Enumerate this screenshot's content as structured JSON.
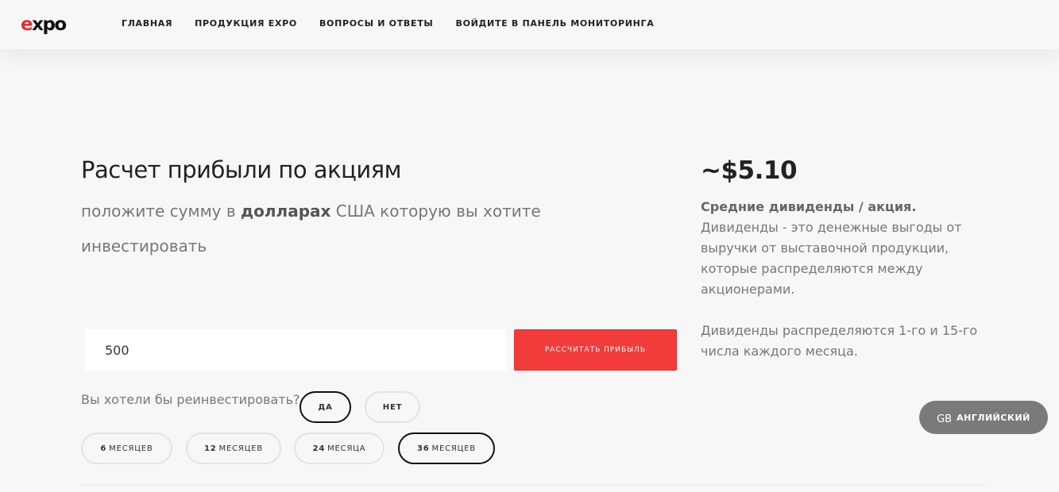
{
  "brand": {
    "logo_e": "e",
    "logo_rest": "xpo",
    "accent_color": "#e52d2d"
  },
  "nav": {
    "items": [
      {
        "label": "ГЛАВНАЯ"
      },
      {
        "label": "ПРОДУКЦИЯ EXPO"
      },
      {
        "label": "ВОПРОСЫ И ОТВЕТЫ"
      },
      {
        "label": "ВОЙДИТЕ В ПАНЕЛЬ МОНИТОРИНГА"
      }
    ]
  },
  "calculator": {
    "title": "Расчет прибыли по акциям",
    "subtitle_before": "положите сумму в",
    "subtitle_bold": "долларах",
    "subtitle_after": "США которую вы хотите инвестировать",
    "amount_value": "500",
    "calculate_button": "РАССЧИТАТЬ ПРИБЫЛЬ",
    "button_color": "#f23b3b",
    "reinvest_question": "Вы хотели бы реинвестировать?",
    "reinvest_options": {
      "yes": "ДА",
      "no": "НЕТ",
      "selected": "yes"
    },
    "periods": [
      {
        "num": "6",
        "unit": "МЕСЯЦЕВ"
      },
      {
        "num": "12",
        "unit": "МЕСЯЦЕВ"
      },
      {
        "num": "24",
        "unit": "МЕСЯЦА"
      },
      {
        "num": "36",
        "unit": "МЕСЯЦЕВ"
      }
    ],
    "selected_period": "36"
  },
  "result": {
    "value": "~$5.10",
    "heading": "Средние дивиденды / акция.",
    "description": "Дивиденды - это денежные выгоды от выручки от выставочной продукции, которые распределяются между акционерами.",
    "note": "Дивиденды распределяются 1-го и 15-го числа каждого месяца."
  },
  "language": {
    "code": "GB",
    "name": "АНГЛИЙСКИЙ"
  }
}
